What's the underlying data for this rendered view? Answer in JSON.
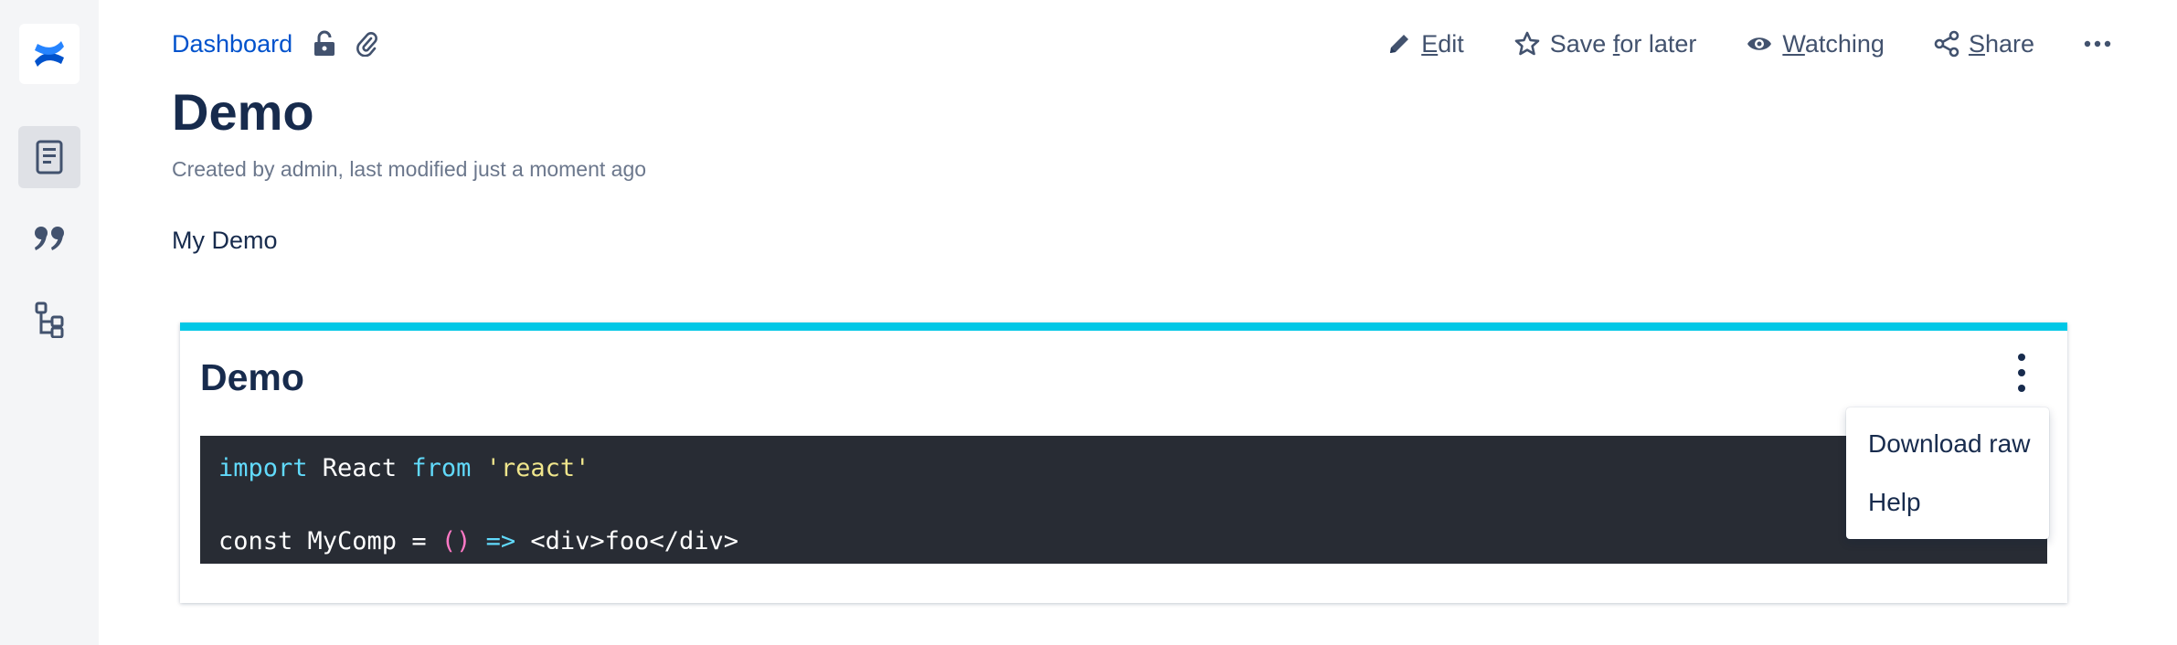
{
  "sidebar": {
    "logo_icon": "confluence-logo-icon",
    "items": [
      {
        "icon": "page-icon",
        "active": true
      },
      {
        "icon": "quote-icon",
        "active": false
      },
      {
        "icon": "page-tree-icon",
        "active": false
      }
    ]
  },
  "breadcrumb": {
    "link": "Dashboard",
    "icons": [
      "unlock-icon",
      "attachment-icon"
    ]
  },
  "actions": {
    "edit": {
      "underline": "E",
      "rest": "dit"
    },
    "save": {
      "before": "Save ",
      "underline": "f",
      "after": "or later"
    },
    "watching": {
      "underline": "W",
      "rest": "atching"
    },
    "share": {
      "underline": "S",
      "rest": "hare"
    }
  },
  "page": {
    "title": "Demo",
    "byline": "Created by admin, last modified just a moment ago",
    "body": "My Demo"
  },
  "panel": {
    "title": "Demo",
    "accent": "#00c7e6",
    "code": {
      "line1": {
        "kw1": "import",
        "name": " React ",
        "kw2": "from",
        "sp": " ",
        "str": "'react'"
      },
      "line3": {
        "lead": "const MyComp = ",
        "parens": "()",
        "sp": " ",
        "arrow": "=>",
        "rest": " <div>foo</div>"
      }
    }
  },
  "menu": {
    "items": [
      "Download raw",
      "Help"
    ]
  },
  "colors": {
    "link": "#0052cc",
    "text": "#172b4d",
    "sidebar_bg": "#f4f5f7",
    "code_bg": "#282c34"
  }
}
